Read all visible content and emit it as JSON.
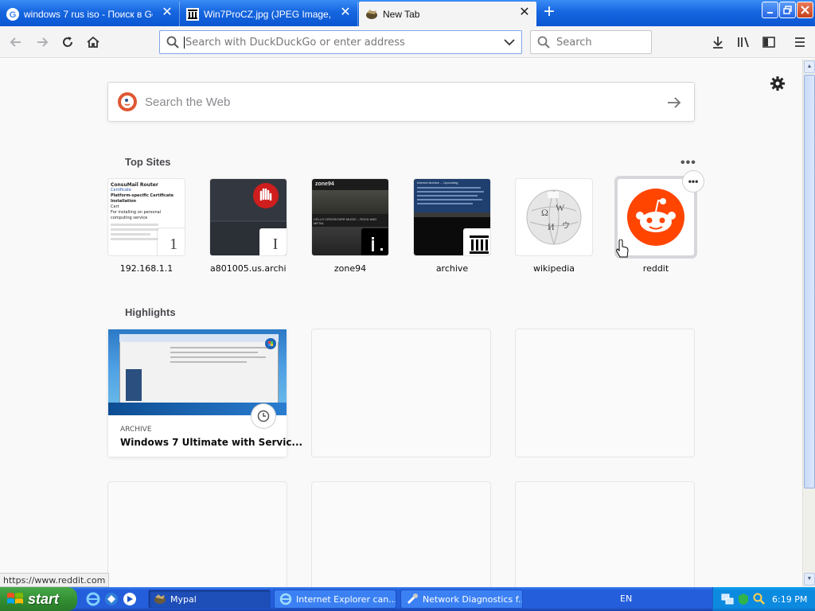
{
  "browser": {
    "tabs": [
      {
        "title": "windows 7 rus iso - Поиск в Googl",
        "icon": "google-icon",
        "active": false
      },
      {
        "title": "Win7ProCZ.jpg (JPEG Image, 192",
        "icon": "archive-icon",
        "active": false
      },
      {
        "title": "New Tab",
        "icon": "firefox-icon",
        "active": true
      }
    ],
    "new_tab_symbol": "+",
    "window_controls": {
      "minimize": "_",
      "restore": "❐",
      "close": "✕"
    }
  },
  "toolbar": {
    "url_placeholder": "Search with DuckDuckGo or enter address",
    "search_placeholder": "Search"
  },
  "newtab": {
    "web_search_placeholder": "Search the Web",
    "top_sites_title": "Top Sites",
    "top_sites": [
      {
        "label": "192.168.1.1",
        "mini": "1"
      },
      {
        "label": "a801005.us.archi...",
        "mini": "I"
      },
      {
        "label": "zone94",
        "mini": ""
      },
      {
        "label": "archive",
        "mini": ""
      },
      {
        "label": "wikipedia",
        "mini": ""
      },
      {
        "label": "reddit",
        "mini": ""
      }
    ],
    "more_dots": "•••",
    "context_dots": "•••",
    "highlights_title": "Highlights",
    "highlights": [
      {
        "source": "ARCHIVE",
        "title": "Windows 7 Ultimate with Servic..."
      }
    ],
    "thumb_text": {
      "router_title": "ConsuMail Router",
      "router_lines": [
        "Certificate",
        "Platform-specific Certificate Installation",
        "Cert",
        "For installing on personal computing service"
      ],
      "zone94_brand": "zone94",
      "zone94_headline": "CELLO CROSSOVER MUSIC – ROCK AND METAL",
      "archive_headline": "Internet Archive ... Upcoming"
    }
  },
  "status_url": "https://www.reddit.com",
  "taskbar": {
    "start_label": "start",
    "tasks": [
      {
        "label": "Mypal",
        "active": true
      },
      {
        "label": "Internet Explorer can...",
        "active": false
      },
      {
        "label": "Network Diagnostics f...",
        "active": false
      }
    ],
    "language": "EN",
    "clock": "6:19 PM"
  },
  "colors": {
    "accent": "#0a84ff",
    "reddit": "#ff4500",
    "xp_blue": "#245edb",
    "xp_green": "#318c31"
  }
}
